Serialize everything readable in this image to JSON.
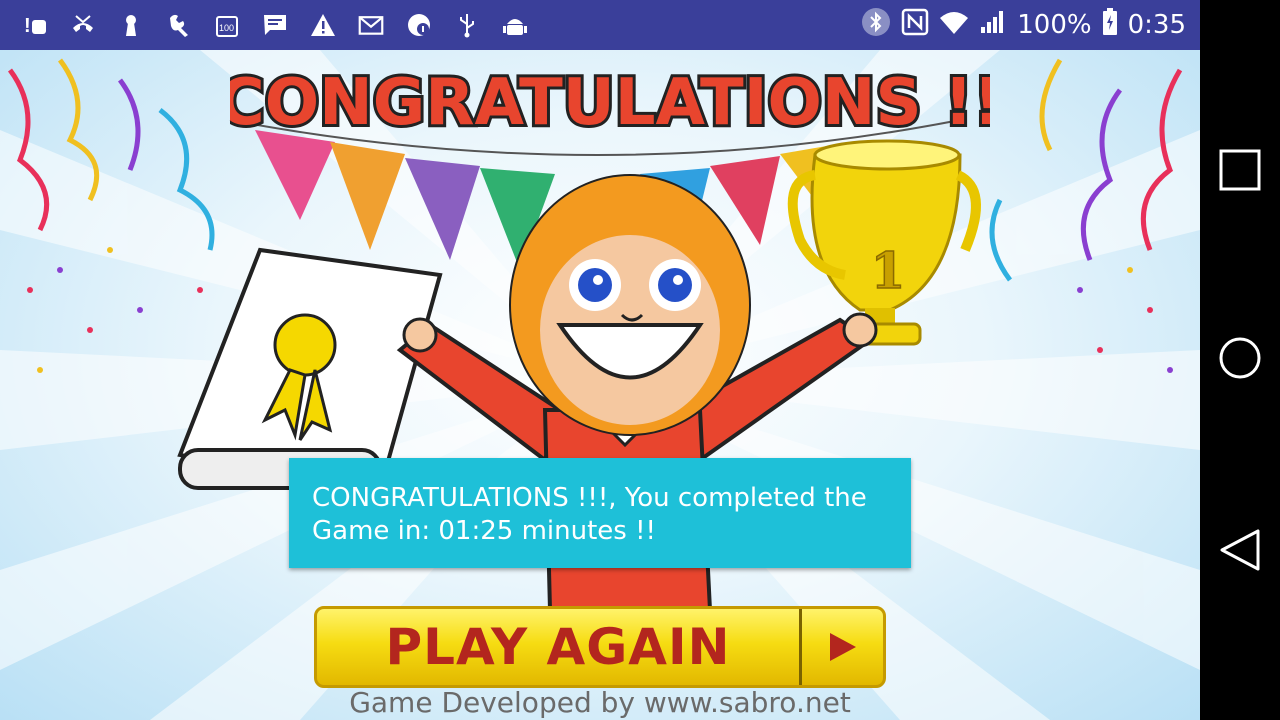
{
  "status_bar": {
    "left_icons": [
      "notification-alert-icon",
      "missed-call-icon",
      "keyhole-icon",
      "wrench-icon",
      "storage-100-icon",
      "message-icon",
      "warning-icon",
      "gmail-icon",
      "update-icon",
      "usb-icon",
      "android-debug-icon"
    ],
    "right_icons": [
      "bluetooth-icon",
      "nfc-icon",
      "wifi-icon",
      "signal-icon",
      "battery-charging-icon"
    ],
    "battery": "100%",
    "time": "0:35"
  },
  "game": {
    "title": "CONGRATULATIONS !!",
    "trophy_number": "1",
    "popup_message": "CONGRATULATIONS !!!, You completed the Game in: 01:25 minutes !!",
    "play_again_label": "PLAY AGAIN",
    "footer": "Game Developed by www.sabro.net"
  },
  "nav": {
    "buttons": [
      "recent-apps-button",
      "home-button",
      "back-button"
    ]
  },
  "colors": {
    "status_bar": "#3a3f9a",
    "popup": "#1ec0d8",
    "play_button": "#f6dc12",
    "play_text": "#b3261e"
  }
}
